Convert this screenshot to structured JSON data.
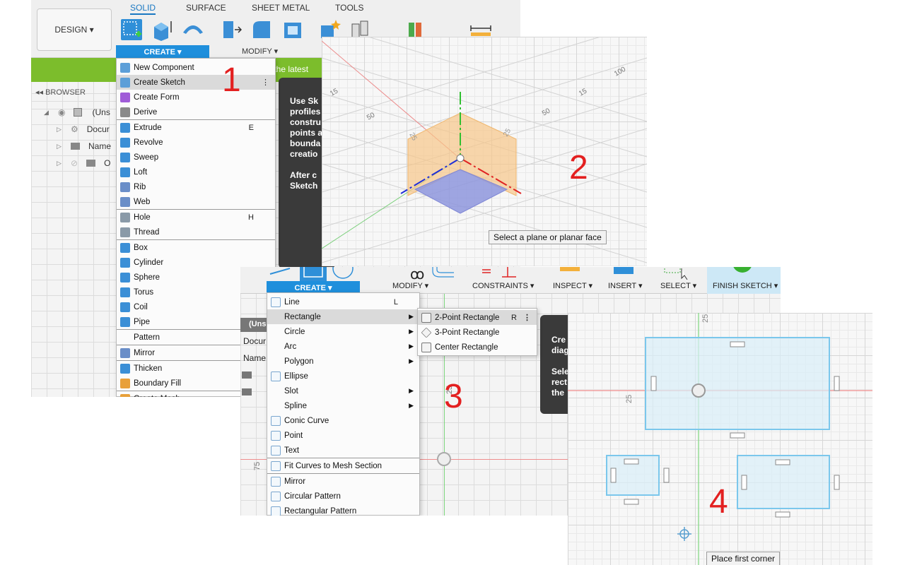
{
  "colors": {
    "accent": "#1f8fdc",
    "number": "#e32020",
    "green_bar": "#7cbd2c",
    "sketch_blue": "#7bc7ec"
  },
  "step_numbers": [
    "1",
    "2",
    "3",
    "4"
  ],
  "panel1": {
    "design_label": "DESIGN ▾",
    "tabs": [
      "SOLID",
      "SURFACE",
      "SHEET METAL",
      "TOOLS"
    ],
    "create_label": "CREATE ▾",
    "modify_label": "MODIFY ▾",
    "green_text": "th the latest",
    "browser_label": "◂◂  BROWSER",
    "tree": [
      "(Uns",
      "Docur",
      "Name",
      "O"
    ],
    "hint_lines": [
      "Use Sk",
      "profiles",
      "constru",
      "points a",
      "bounda",
      "creatio",
      "",
      "After c",
      "Sketch"
    ],
    "menu": [
      {
        "label": "New Component",
        "icon": "new-component-icon",
        "shortcut": ""
      },
      {
        "label": "Create Sketch",
        "icon": "create-sketch-icon",
        "shortcut": "⋮"
      },
      {
        "label": "Create Form",
        "icon": "create-form-icon",
        "shortcut": ""
      },
      {
        "label": "Derive",
        "icon": "derive-icon",
        "shortcut": ""
      },
      {
        "label": "Extrude",
        "icon": "extrude-icon",
        "shortcut": "E"
      },
      {
        "label": "Revolve",
        "icon": "revolve-icon",
        "shortcut": ""
      },
      {
        "label": "Sweep",
        "icon": "sweep-icon",
        "shortcut": ""
      },
      {
        "label": "Loft",
        "icon": "loft-icon",
        "shortcut": ""
      },
      {
        "label": "Rib",
        "icon": "rib-icon",
        "shortcut": ""
      },
      {
        "label": "Web",
        "icon": "web-icon",
        "shortcut": ""
      },
      {
        "label": "Hole",
        "icon": "hole-icon",
        "shortcut": "H"
      },
      {
        "label": "Thread",
        "icon": "thread-icon",
        "shortcut": ""
      },
      {
        "label": "Box",
        "icon": "box-icon",
        "shortcut": ""
      },
      {
        "label": "Cylinder",
        "icon": "cylinder-icon",
        "shortcut": ""
      },
      {
        "label": "Sphere",
        "icon": "sphere-icon",
        "shortcut": ""
      },
      {
        "label": "Torus",
        "icon": "torus-icon",
        "shortcut": ""
      },
      {
        "label": "Coil",
        "icon": "coil-icon",
        "shortcut": ""
      },
      {
        "label": "Pipe",
        "icon": "pipe-icon",
        "shortcut": ""
      },
      {
        "label": "Pattern",
        "icon": "",
        "shortcut": ""
      },
      {
        "label": "Mirror",
        "icon": "mirror-icon",
        "shortcut": ""
      },
      {
        "label": "Thicken",
        "icon": "thicken-icon",
        "shortcut": ""
      },
      {
        "label": "Boundary Fill",
        "icon": "boundary-fill-icon",
        "shortcut": ""
      },
      {
        "label": "Create Mesh",
        "icon": "create-mesh-icon",
        "shortcut": ""
      }
    ]
  },
  "panel2": {
    "axis_labels": [
      "15",
      "50",
      "100",
      "15",
      "50",
      "25",
      "25"
    ],
    "tooltip": "Select a plane or planar face"
  },
  "panel3": {
    "toolbar": {
      "create": "CREATE ▾",
      "modify": "MODIFY ▾",
      "constraints": "CONSTRAINTS ▾",
      "inspect": "INSPECT ▾",
      "insert": "INSERT ▾",
      "select": "SELECT ▾",
      "finish": "FINISH SKETCH ▾"
    },
    "tree": [
      "(Uns",
      "Docur",
      "Name"
    ],
    "hint_lines": [
      "Cre",
      "diag",
      "",
      "Sele",
      "rect",
      "the"
    ],
    "axis_labels": [
      "25",
      "75"
    ],
    "menu": [
      {
        "label": "Line",
        "icon": "line-icon",
        "shortcut": "L",
        "arrow": false
      },
      {
        "label": "Rectangle",
        "icon": "",
        "shortcut": "",
        "arrow": true
      },
      {
        "label": "Circle",
        "icon": "",
        "shortcut": "",
        "arrow": true
      },
      {
        "label": "Arc",
        "icon": "",
        "shortcut": "",
        "arrow": true
      },
      {
        "label": "Polygon",
        "icon": "",
        "shortcut": "",
        "arrow": true
      },
      {
        "label": "Ellipse",
        "icon": "ellipse-icon",
        "shortcut": "",
        "arrow": false
      },
      {
        "label": "Slot",
        "icon": "",
        "shortcut": "",
        "arrow": true
      },
      {
        "label": "Spline",
        "icon": "",
        "shortcut": "",
        "arrow": true
      },
      {
        "label": "Conic Curve",
        "icon": "conic-curve-icon",
        "shortcut": "",
        "arrow": false
      },
      {
        "label": "Point",
        "icon": "point-icon",
        "shortcut": "",
        "arrow": false
      },
      {
        "label": "Text",
        "icon": "text-icon",
        "shortcut": "",
        "arrow": false
      },
      {
        "label": "Fit Curves to Mesh Section",
        "icon": "fit-curves-icon",
        "shortcut": "",
        "arrow": false
      },
      {
        "label": "Mirror",
        "icon": "mirror-icon",
        "shortcut": "",
        "arrow": false
      },
      {
        "label": "Circular Pattern",
        "icon": "circular-pattern-icon",
        "shortcut": "",
        "arrow": false
      },
      {
        "label": "Rectangular Pattern",
        "icon": "rectangular-pattern-icon",
        "shortcut": "",
        "arrow": false
      }
    ],
    "submenu": [
      {
        "label": "2-Point Rectangle",
        "shortcut": "R",
        "more": "⋮"
      },
      {
        "label": "3-Point Rectangle",
        "shortcut": "",
        "more": ""
      },
      {
        "label": "Center Rectangle",
        "shortcut": "",
        "more": ""
      }
    ]
  },
  "panel4": {
    "axis_labels": [
      "25",
      "25"
    ],
    "tooltip": "Place first corner"
  }
}
